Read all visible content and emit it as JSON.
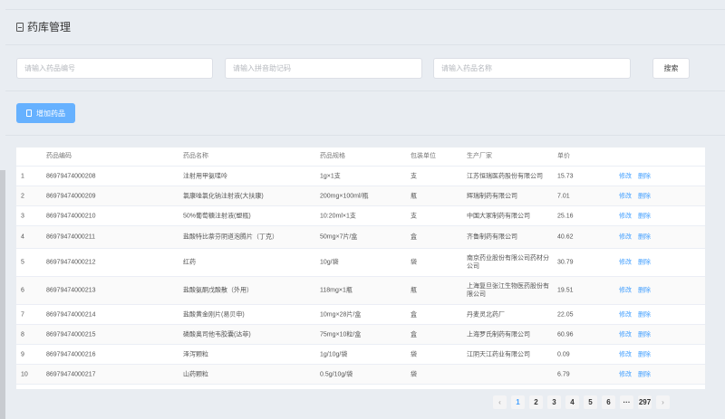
{
  "header": {
    "title": "药库管理"
  },
  "search": {
    "code_placeholder": "请输入药品编号",
    "pinyin_placeholder": "请输入拼音助记码",
    "name_placeholder": "请输入药品名称",
    "button_label": "搜索"
  },
  "toolbar": {
    "add_label": "增加药品"
  },
  "table": {
    "columns": [
      "药品编码",
      "药品名称",
      "药品规格",
      "包装单位",
      "生产厂家",
      "单价"
    ],
    "edit_label": "修改",
    "delete_label": "删除",
    "rows": [
      {
        "idx": "1",
        "code": "86979474000208",
        "name": "注射用甲氨喋呤",
        "spec": "1g×1支",
        "unit": "支",
        "maker": "江苏恒瑞医药股份有限公司",
        "price": "15.73"
      },
      {
        "idx": "2",
        "code": "86979474000209",
        "name": "氯康唑氯化钠注射液(大扶康)",
        "spec": "200mg×100ml/瓶",
        "unit": "瓶",
        "maker": "辉瑞制药有限公司",
        "price": "7.01"
      },
      {
        "idx": "3",
        "code": "86979474000210",
        "name": "50%葡萄糖注射液(塑瓶)",
        "spec": "10:20ml×1支",
        "unit": "支",
        "maker": "中国大冢制药有限公司",
        "price": "25.16"
      },
      {
        "idx": "4",
        "code": "86979474000211",
        "name": "盐酸特比萘芬阴道泡腾片（丁克）",
        "spec": "50mg×7片/盒",
        "unit": "盒",
        "maker": "齐鲁制药有限公司",
        "price": "40.62"
      },
      {
        "idx": "5",
        "code": "86979474000212",
        "name": "红药",
        "spec": "10g/袋",
        "unit": "袋",
        "maker": "南京药业股份有限公司药材分公司",
        "price": "30.79"
      },
      {
        "idx": "6",
        "code": "86979474000213",
        "name": "盐酸氨酮戊酸散（外用）",
        "spec": "118mg×1瓶",
        "unit": "瓶",
        "maker": "上海复旦张江生物医药股份有限公司",
        "price": "19.51"
      },
      {
        "idx": "7",
        "code": "86979474000214",
        "name": "盐酸黄金刚片(易贝申)",
        "spec": "10mg×28片/盒",
        "unit": "盒",
        "maker": "丹麦灵北药厂",
        "price": "22.05"
      },
      {
        "idx": "8",
        "code": "86979474000215",
        "name": "磷酸奥司他韦胶囊(达菲)",
        "spec": "75mg×10粒/盒",
        "unit": "盒",
        "maker": "上海罗氏制药有限公司",
        "price": "60.96"
      },
      {
        "idx": "9",
        "code": "86979474000216",
        "name": "泽泻颗粒",
        "spec": "1g/10g/袋",
        "unit": "袋",
        "maker": "江阴天江药业有限公司",
        "price": "0.09"
      },
      {
        "idx": "10",
        "code": "86979474000217",
        "name": "山药颗粒",
        "spec": "0.5g/10g/袋",
        "unit": "袋",
        "maker": "",
        "price": "6.79"
      }
    ]
  },
  "pagination": {
    "prev": "‹",
    "pages": [
      "1",
      "2",
      "3",
      "4",
      "5",
      "6"
    ],
    "ellipsis": "···",
    "last": "297",
    "next": "›"
  }
}
